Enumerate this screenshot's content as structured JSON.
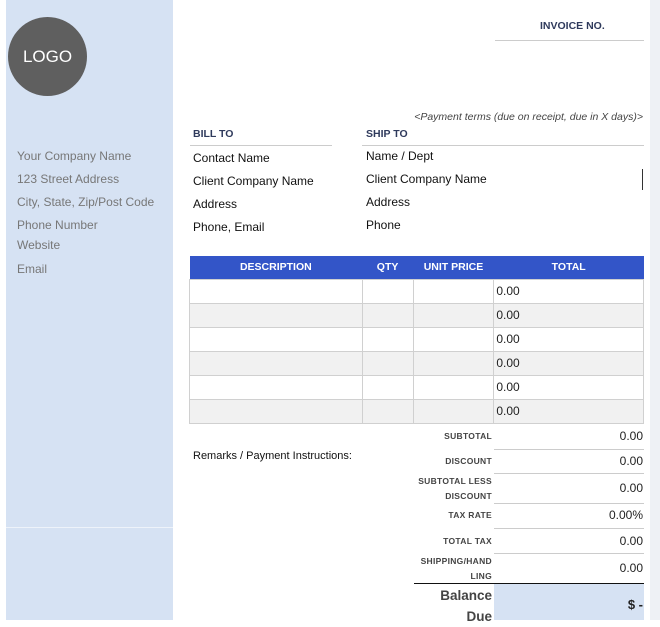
{
  "logo": "LOGO",
  "company": [
    "Your Company Name",
    "123 Street Address",
    "City, State, Zip/Post Code",
    "Phone Number",
    "Website",
    "Email"
  ],
  "invoice_no_label": "INVOICE NO.",
  "payment_terms": "<Payment terms (due on receipt, due in X days)>",
  "bill_to": {
    "label": "BILL TO",
    "lines": [
      "Contact Name",
      "Client Company Name",
      "Address",
      "Phone, Email"
    ]
  },
  "ship_to": {
    "label": "SHIP TO",
    "lines": [
      "Name / Dept",
      "Client Company Name",
      "Address",
      "Phone"
    ]
  },
  "table": {
    "headers": [
      "DESCRIPTION",
      "QTY",
      "UNIT PRICE",
      "TOTAL"
    ],
    "rows": [
      "0.00",
      "0.00",
      "0.00",
      "0.00",
      "0.00",
      "0.00"
    ]
  },
  "remarks": "Remarks / Payment Instructions:",
  "totals": {
    "subtotal": {
      "label": "SUBTOTAL",
      "value": "0.00"
    },
    "discount": {
      "label": "DISCOUNT",
      "value": "0.00"
    },
    "subtotal_less": {
      "label1": "SUBTOTAL LESS",
      "label2": "DISCOUNT",
      "value": "0.00"
    },
    "tax_rate": {
      "label": "TAX RATE",
      "value": "0.00%"
    },
    "total_tax": {
      "label": "TOTAL TAX",
      "value": "0.00"
    },
    "shipping": {
      "label1": "SHIPPING/HAND",
      "label2": "LING",
      "value": "0.00"
    },
    "balance": {
      "label1": "Balance",
      "label2": "Due",
      "value": "$ -"
    }
  },
  "colors": {
    "sidebar": "#d6e2f3",
    "header": "#3355c8"
  }
}
